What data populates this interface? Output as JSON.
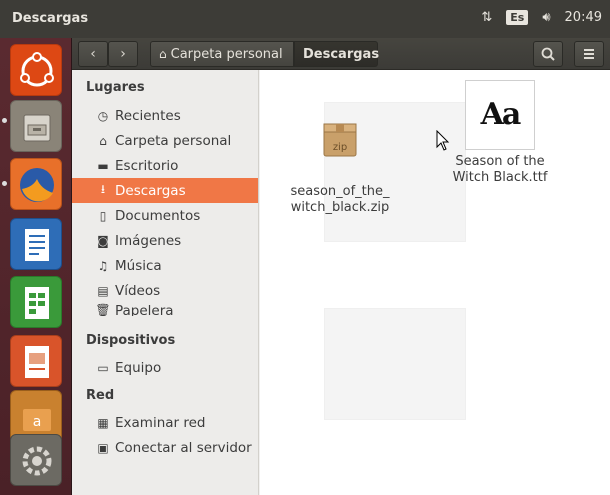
{
  "panel": {
    "title": "Descargas",
    "keyboard_layout": "Es",
    "time": "20:49"
  },
  "launcher": {
    "items": [
      "ubuntu-dash",
      "files",
      "firefox",
      "writer",
      "calc",
      "impress",
      "software-center",
      "system-settings"
    ]
  },
  "toolbar": {
    "back": "‹",
    "forward": "›",
    "crumb_home": "Carpeta personal",
    "crumb_current": "Descargas"
  },
  "sidebar": {
    "places_header": "Lugares",
    "places": [
      {
        "label": "Recientes",
        "icon": "clock-icon"
      },
      {
        "label": "Carpeta personal",
        "icon": "home-icon"
      },
      {
        "label": "Escritorio",
        "icon": "folder-icon"
      },
      {
        "label": "Descargas",
        "icon": "download-icon"
      },
      {
        "label": "Documentos",
        "icon": "document-icon"
      },
      {
        "label": "Imágenes",
        "icon": "camera-icon"
      },
      {
        "label": "Música",
        "icon": "music-icon"
      },
      {
        "label": "Vídeos",
        "icon": "film-icon"
      },
      {
        "label": "Papelera",
        "icon": "trash-icon"
      }
    ],
    "devices_header": "Dispositivos",
    "devices": [
      {
        "label": "Equipo",
        "icon": "computer-icon"
      }
    ],
    "network_header": "Red",
    "network": [
      {
        "label": "Examinar red",
        "icon": "network-icon"
      },
      {
        "label": "Conectar al servidor",
        "icon": "server-icon"
      }
    ]
  },
  "files": [
    {
      "name_line1": "season_of_the_",
      "name_line2": "witch_black.zip",
      "badge": "zip"
    },
    {
      "name_line1": "Season of the",
      "name_line2": "Witch Black.ttf",
      "preview": "Aa"
    }
  ],
  "colors": {
    "accent": "#f07746",
    "launcher": "#4a2127",
    "panel": "#3d3c37"
  }
}
